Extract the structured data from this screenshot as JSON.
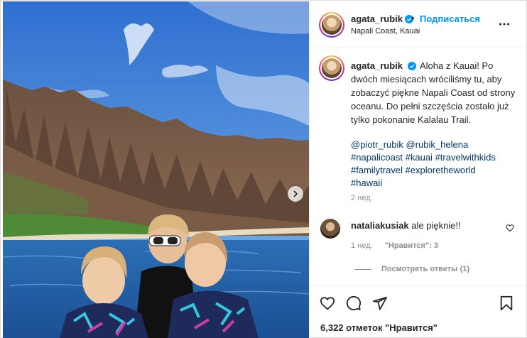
{
  "post": {
    "author": {
      "username": "agata_rubik",
      "verified": true,
      "follow_label": "Подписаться",
      "separator": "•",
      "location": "Napali Coast, Kauai"
    },
    "caption": {
      "username": "agata_rubik",
      "text": "Aloha z Kauai! Po dwóch miesiącach wróciliśmy tu, aby zobaczyć piękne Napali Coast od strony oceanu. Do pełni szczęścia zostało już tylko pokonanie Kalalau Trail.",
      "mentions": [
        "@piotr_rubik",
        "@rubik_helena"
      ],
      "hashtags": [
        "#napalicoast",
        "#kauai",
        "#travelwithkids",
        "#familytravel",
        "#exploretheworld",
        "#hawaii"
      ],
      "time": "2 нед."
    },
    "comments": [
      {
        "username": "nataliakusiak",
        "text": "ale pięknie!!",
        "time": "1 нед.",
        "likes": "\"Нравится\": 3",
        "view_replies": "Посмотреть ответы (1)"
      }
    ],
    "likes_summary": "6,322 отметок \"Нравится\"",
    "icons": {
      "more": "more-horizontal-icon",
      "like": "heart-icon",
      "comment": "comment-icon",
      "share": "send-icon",
      "save": "bookmark-icon",
      "next": "chevron-right-icon"
    },
    "colors": {
      "accent": "#0095f6",
      "link": "#00376b",
      "muted": "#8e8e8e",
      "text": "#262626"
    }
  }
}
